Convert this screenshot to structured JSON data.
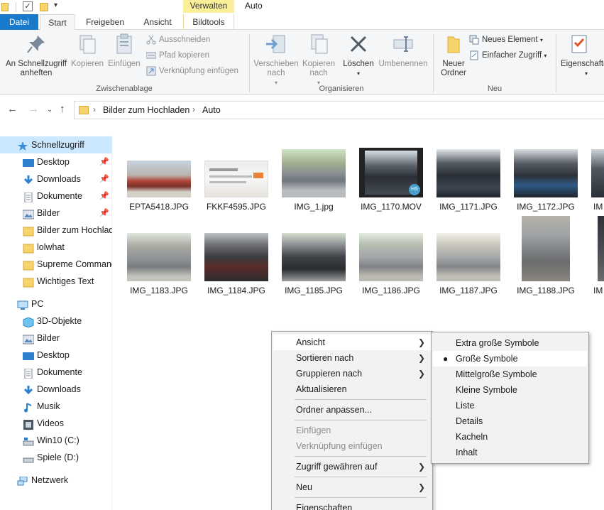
{
  "colors": {
    "accent": "#1979ca",
    "verwalten_bg": "#f9ef98",
    "nav_selected": "#cce8ff",
    "menu_bg": "#f2f2f2",
    "folder_yellow": "#f6d36b"
  },
  "window": {
    "title": "Auto",
    "contextual_tab_header": "Verwalten"
  },
  "tabs": {
    "datei": "Datei",
    "start": "Start",
    "freigeben": "Freigeben",
    "ansicht": "Ansicht",
    "bildtools": "Bildtools"
  },
  "ribbon": {
    "pin_quick_access": "An Schnellzugriff anheften",
    "copy": "Kopieren",
    "paste": "Einfügen",
    "cut": "Ausschneiden",
    "copy_path": "Pfad kopieren",
    "paste_shortcut": "Verknüpfung einfügen",
    "group_clipboard": "Zwischenablage",
    "move_to": "Verschieben nach",
    "copy_to": "Kopieren nach",
    "delete": "Löschen",
    "rename": "Umbenennen",
    "group_organize": "Organisieren",
    "new_folder": "Neuer Ordner",
    "new_item": "Neues Element",
    "easy_access": "Einfacher Zugriff",
    "group_new": "Neu",
    "properties": "Eigenschaften"
  },
  "address": {
    "crumbs": [
      "Bilder zum Hochladen",
      "Auto"
    ]
  },
  "nav": {
    "quick_access": "Schnellzugriff",
    "desktop": "Desktop",
    "downloads": "Downloads",
    "dokumente": "Dokumente",
    "bilder": "Bilder",
    "bilder_hochladen": "Bilder zum Hochladen",
    "lolwhat": "lolwhat",
    "supreme": "Supreme Commander",
    "wichtiges": "Wichtiges Text",
    "pc": "PC",
    "objekte3d": "3D-Objekte",
    "pc_bilder": "Bilder",
    "pc_desktop": "Desktop",
    "pc_dokumente": "Dokumente",
    "pc_downloads": "Downloads",
    "musik": "Musik",
    "videos": "Videos",
    "win10": "Win10 (C:)",
    "spiele": "Spiele (D:)",
    "netzwerk": "Netzwerk"
  },
  "files": [
    {
      "name": "EPTA5418.JPG"
    },
    {
      "name": "FKKF4595.JPG"
    },
    {
      "name": "IMG_1.jpg"
    },
    {
      "name": "IMG_1170.MOV"
    },
    {
      "name": "IMG_1171.JPG"
    },
    {
      "name": "IMG_1172.JPG"
    },
    {
      "name": "IM"
    },
    {
      "name": "IMG_1183.JPG"
    },
    {
      "name": "IMG_1184.JPG"
    },
    {
      "name": "IMG_1185.JPG"
    },
    {
      "name": "IMG_1186.JPG"
    },
    {
      "name": "IMG_1187.JPG"
    },
    {
      "name": "IMG_1188.JPG"
    },
    {
      "name": "IM"
    }
  ],
  "context_menu": {
    "ansicht": "Ansicht",
    "sortieren": "Sortieren nach",
    "gruppieren": "Gruppieren nach",
    "aktualisieren": "Aktualisieren",
    "ordner_anpassen": "Ordner anpassen...",
    "einfuegen": "Einfügen",
    "verknuepfung": "Verknüpfung einfügen",
    "zugriff": "Zugriff gewähren auf",
    "neu": "Neu",
    "eigenschaften": "Eigenschaften"
  },
  "view_submenu": {
    "extra_gross": "Extra große Symbole",
    "gross": "Große Symbole",
    "mittel": "Mittelgroße Symbole",
    "klein": "Kleine Symbole",
    "liste": "Liste",
    "details": "Details",
    "kacheln": "Kacheln",
    "inhalt": "Inhalt",
    "selected": "Große Symbole"
  }
}
